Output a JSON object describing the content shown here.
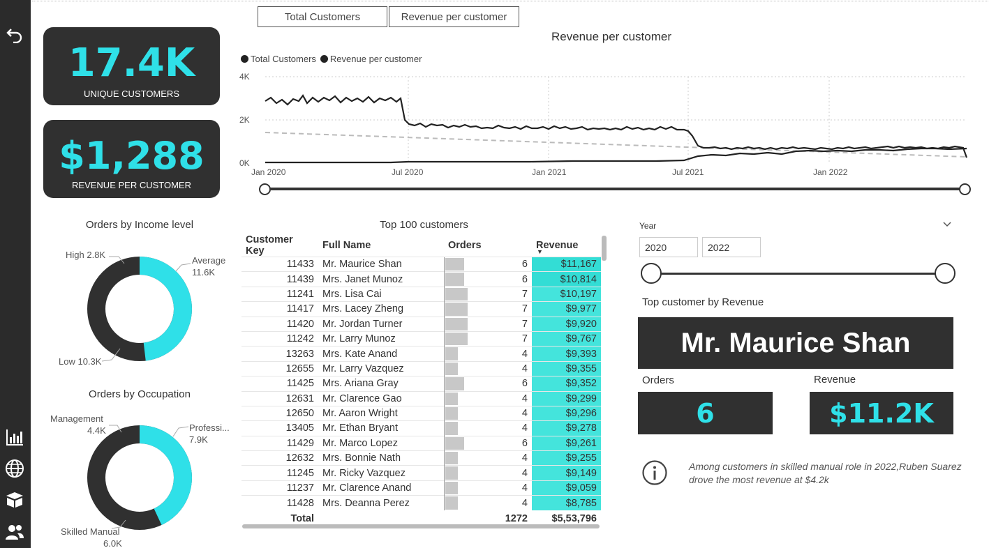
{
  "sidebar": {
    "items": [
      "back-icon",
      "report-icon",
      "globe-icon",
      "box-icon",
      "people-icon"
    ]
  },
  "kpis": {
    "unique_customers": {
      "value": "17.4K",
      "label": "UNIQUE CUSTOMERS"
    },
    "revenue_per_customer": {
      "value": "$1,288",
      "label": "REVENUE PER CUSTOMER"
    }
  },
  "tabs": {
    "total_customers": "Total Customers",
    "revenue_per_customer": "Revenue per customer"
  },
  "line_chart": {
    "title": "Revenue per customer",
    "legend": [
      "Total Customers",
      "Revenue per customer"
    ],
    "y_ticks": [
      "4K",
      "2K",
      "0K"
    ],
    "x_ticks": [
      "Jan 2020",
      "Jul 2020",
      "Jan 2021",
      "Jul 2021",
      "Jan 2022"
    ]
  },
  "income_donut": {
    "title": "Orders by Income level",
    "labels": {
      "high": "High 2.8K",
      "average": "Average",
      "average_val": "11.6K",
      "low": "Low 10.3K"
    }
  },
  "occupation_donut": {
    "title": "Orders by Occupation",
    "labels": {
      "management": "Management",
      "management_val": "4.4K",
      "professional": "Professi...",
      "professional_val": "7.9K",
      "skilled": "Skilled Manual",
      "skilled_val": "6.0K"
    }
  },
  "table": {
    "title": "Top 100 customers",
    "headers": {
      "key": "Customer Key",
      "name": "Full Name",
      "orders": "Orders",
      "revenue": "Revenue"
    },
    "rows": [
      {
        "key": "11433",
        "name": "Mr. Maurice Shan",
        "orders": "6",
        "revenue": "$11,167"
      },
      {
        "key": "11439",
        "name": "Mrs. Janet Munoz",
        "orders": "6",
        "revenue": "$10,814"
      },
      {
        "key": "11241",
        "name": "Mrs. Lisa Cai",
        "orders": "7",
        "revenue": "$10,197"
      },
      {
        "key": "11417",
        "name": "Mrs. Lacey Zheng",
        "orders": "7",
        "revenue": "$9,977"
      },
      {
        "key": "11420",
        "name": "Mr. Jordan Turner",
        "orders": "7",
        "revenue": "$9,920"
      },
      {
        "key": "11242",
        "name": "Mr. Larry Munoz",
        "orders": "7",
        "revenue": "$9,767"
      },
      {
        "key": "13263",
        "name": "Mrs. Kate Anand",
        "orders": "4",
        "revenue": "$9,393"
      },
      {
        "key": "12655",
        "name": "Mr. Larry Vazquez",
        "orders": "4",
        "revenue": "$9,355"
      },
      {
        "key": "11425",
        "name": "Mrs. Ariana Gray",
        "orders": "6",
        "revenue": "$9,352"
      },
      {
        "key": "12631",
        "name": "Mr. Clarence Gao",
        "orders": "4",
        "revenue": "$9,299"
      },
      {
        "key": "12650",
        "name": "Mr. Aaron Wright",
        "orders": "4",
        "revenue": "$9,296"
      },
      {
        "key": "13405",
        "name": "Mr. Ethan Bryant",
        "orders": "4",
        "revenue": "$9,278"
      },
      {
        "key": "11429",
        "name": "Mr. Marco Lopez",
        "orders": "6",
        "revenue": "$9,261"
      },
      {
        "key": "12632",
        "name": "Mrs. Bonnie Nath",
        "orders": "4",
        "revenue": "$9,255"
      },
      {
        "key": "11245",
        "name": "Mr. Ricky Vazquez",
        "orders": "4",
        "revenue": "$9,149"
      },
      {
        "key": "11237",
        "name": "Mr. Clarence Anand",
        "orders": "4",
        "revenue": "$9,059"
      },
      {
        "key": "11428",
        "name": "Mrs. Deanna Perez",
        "orders": "4",
        "revenue": "$8,785"
      }
    ],
    "total": {
      "label": "Total",
      "orders": "1272",
      "revenue": "$5,53,796"
    }
  },
  "year_filter": {
    "label": "Year",
    "from": "2020",
    "to": "2022"
  },
  "top_customer": {
    "label": "Top customer by Revenue",
    "name": "Mr. Maurice Shan",
    "orders_label": "Orders",
    "orders_value": "6",
    "revenue_label": "Revenue",
    "revenue_value": "$11.2K"
  },
  "insight": {
    "text": "Among customers in skilled manual role in 2022,Ruben Suarez drove the most revenue at $4.2k"
  },
  "colors": {
    "cyan": "#2fe0e8",
    "dark": "#303030",
    "yellow": "#e3c233",
    "teal_bar": "#40e0d8"
  }
}
